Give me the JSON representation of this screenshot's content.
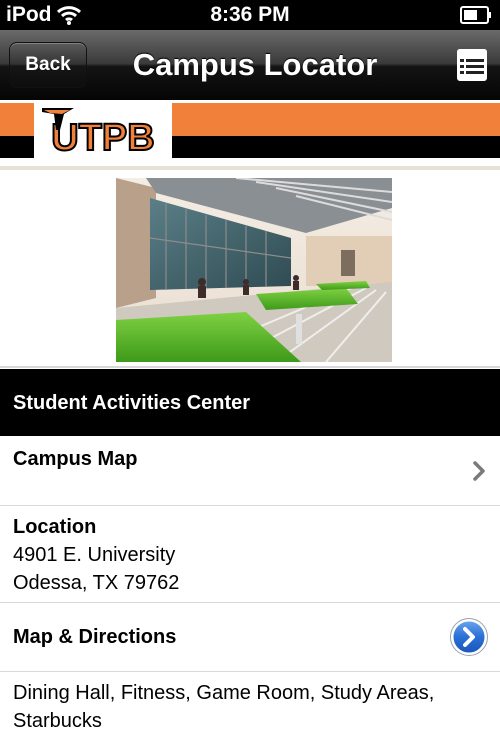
{
  "status_bar": {
    "carrier": "iPod",
    "time": "8:36 PM"
  },
  "nav": {
    "back_label": "Back",
    "title": "Campus Locator"
  },
  "banner": {
    "logo_text": "UTPB",
    "colors": {
      "orange": "#f0803a",
      "black": "#000000"
    }
  },
  "section": {
    "title": "Student Activities Center"
  },
  "rows": {
    "campus_map": {
      "title": "Campus Map"
    },
    "location": {
      "title": "Location",
      "address_line1": "4901 E. University",
      "address_line2": "Odessa, TX 79762"
    },
    "directions": {
      "title": "Map & Directions"
    },
    "amenities": {
      "line1": "Dining Hall, Fitness, Game Room, Study Areas,",
      "line2": "Starbucks"
    }
  },
  "icons": {
    "wifi": "wifi-icon",
    "battery": "battery-icon",
    "menu": "list-menu-icon",
    "chevron": "chevron-right-icon",
    "disclosure": "blue-disclosure-icon"
  }
}
